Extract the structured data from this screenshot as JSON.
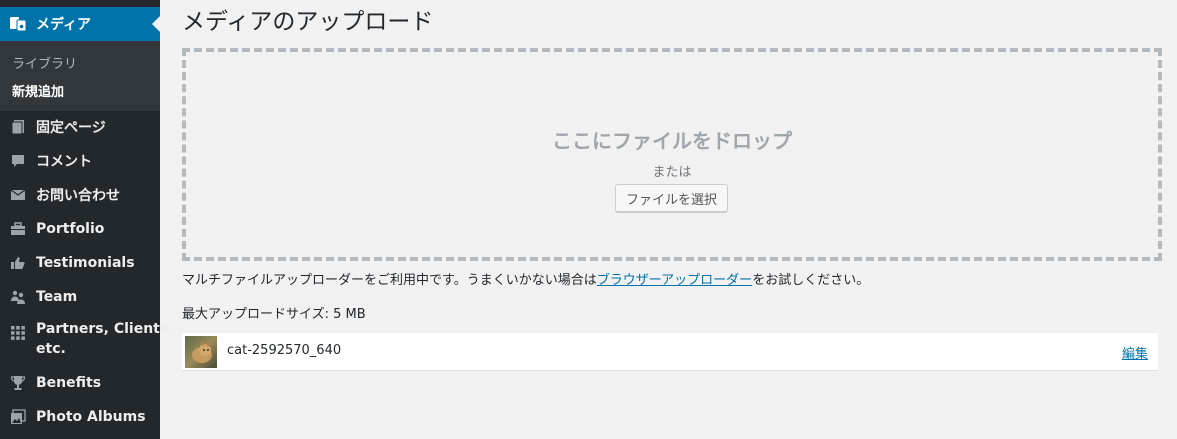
{
  "sidebar": {
    "current": {
      "label": "メディア",
      "icon": "media-icon"
    },
    "submenu": [
      {
        "label": "ライブラリ"
      },
      {
        "label": "新規追加"
      }
    ],
    "items": [
      {
        "label": "固定ページ",
        "icon": "pages-icon"
      },
      {
        "label": "コメント",
        "icon": "comment-icon"
      },
      {
        "label": "お問い合わせ",
        "icon": "email-icon"
      },
      {
        "label": "Portfolio",
        "icon": "portfolio-icon"
      },
      {
        "label": "Testimonials",
        "icon": "thumbs-up-icon"
      },
      {
        "label": "Team",
        "icon": "team-icon"
      },
      {
        "label_line1": "Partners, Clients,",
        "label_line2": "etc.",
        "icon": "grid-icon"
      },
      {
        "label": "Benefits",
        "icon": "trophy-icon"
      },
      {
        "label": "Photo Albums",
        "icon": "photo-albums-icon"
      }
    ],
    "colors": {
      "bg": "#23282d",
      "current": "#0073aa",
      "submenu_bg": "#32373c"
    }
  },
  "main": {
    "title": "メディアのアップロード",
    "dropzone": {
      "title": "ここにファイルをドロップ",
      "or": "または",
      "button": "ファイルを選択"
    },
    "info": {
      "prefix": "マルチファイルアップローダーをご利用中です。うまくいかない場合は",
      "link": "ブラウザーアップローダー",
      "suffix": "をお試しください。"
    },
    "max_size": "最大アップロードサイズ: 5 MB",
    "uploaded": {
      "filename": "cat-2592570_640",
      "edit": "編集",
      "thumbnail": "cat-thumbnail"
    }
  }
}
